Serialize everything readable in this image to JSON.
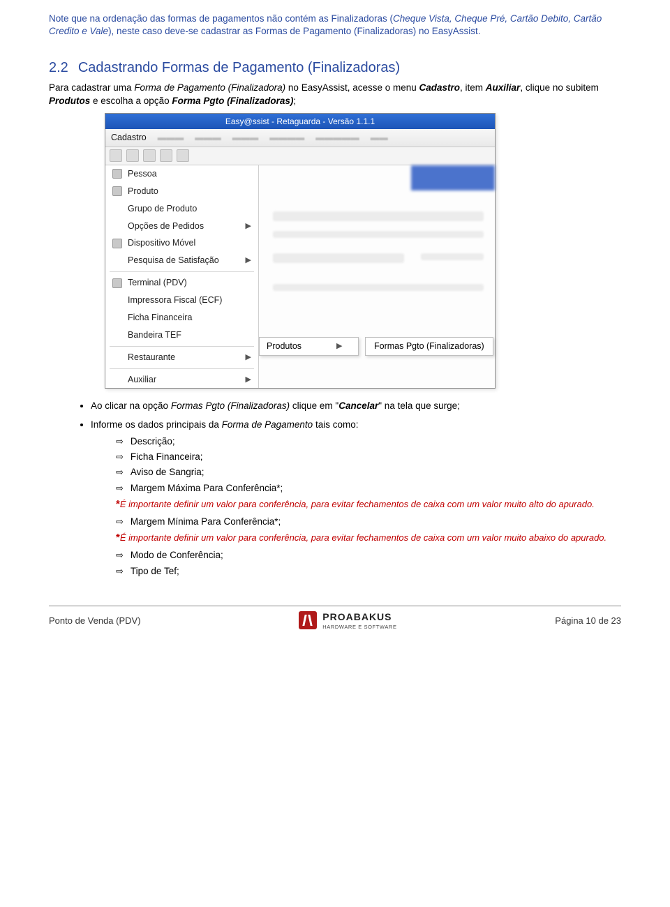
{
  "intro_note": {
    "prefix": "Note que na ordenação das formas de pagamentos não contém as Finalizadoras (",
    "examples": "Cheque Vista, Cheque Pré, Cartão Debito, Cartão Credito e Vale",
    "suffix": "), neste caso deve-se cadastrar as Formas de Pagamento (Finalizadoras) no EasyAssist."
  },
  "section": {
    "number": "2.2",
    "title": "Cadastrando Formas de Pagamento (Finalizadoras)",
    "body_parts": {
      "p1": "Para cadastrar uma ",
      "p2_it": "Forma de Pagamento (Finalizadora)",
      "p3": " no EasyAssist, acesse o menu ",
      "p4_bi": "Cadastro",
      "p5": ", item ",
      "p6_bi": "Auxiliar",
      "p7": ", clique no subitem ",
      "p8_bi": "Produtos",
      "p9": " e escolha a opção ",
      "p10_bi": "Forma Pgto (Finalizadoras)",
      "p11": ";"
    }
  },
  "screenshot": {
    "titlebar": "Easy@ssist - Retaguarda - Versão 1.1.1",
    "menubar_active": "Cadastro",
    "dropdown_items": [
      {
        "label": "Pessoa",
        "icon": true,
        "arrow": false
      },
      {
        "label": "Produto",
        "icon": true,
        "arrow": false
      },
      {
        "label": "Grupo de Produto",
        "icon": false,
        "arrow": false
      },
      {
        "label": "Opções de Pedidos",
        "icon": false,
        "arrow": true
      },
      {
        "label": "Dispositivo Móvel",
        "icon": true,
        "arrow": false
      },
      {
        "label": "Pesquisa de Satisfação",
        "icon": false,
        "arrow": true
      },
      {
        "label": "__sep__"
      },
      {
        "label": "Terminal (PDV)",
        "icon": true,
        "arrow": false
      },
      {
        "label": "Impressora Fiscal (ECF)",
        "icon": false,
        "arrow": false
      },
      {
        "label": "Ficha Financeira",
        "icon": false,
        "arrow": false
      },
      {
        "label": "Bandeira TEF",
        "icon": false,
        "arrow": false
      },
      {
        "label": "__sep__"
      },
      {
        "label": "Restaurante",
        "icon": false,
        "arrow": true
      },
      {
        "label": "__sep__"
      },
      {
        "label": "Auxiliar",
        "icon": false,
        "arrow": true
      }
    ],
    "flyout1": "Produtos",
    "flyout2": "Formas Pgto (Finalizadoras)"
  },
  "bullets": {
    "b1_parts": {
      "p1": "Ao clicar na opção ",
      "p2_it": "Formas Pgto (Finalizadoras)",
      "p3": " clique em \"",
      "p4_bi": "Cancelar",
      "p5": "\" na tela que surge;"
    },
    "b2_parts": {
      "p1": "Informe os dados principais da ",
      "p2_it": "Forma de Pagamento",
      "p3": " tais como:"
    },
    "sub": {
      "s1": "Descrição;",
      "s2": "Ficha Financeira;",
      "s3": "Aviso de Sangria;",
      "s4": "Margem Máxima Para Conferência*;",
      "note1": "É importante definir um valor para conferência, para evitar fechamentos de caixa com um valor muito alto do apurado.",
      "s5": "Margem Mínima Para Conferência*;",
      "note2": "É importante definir um valor para conferência, para evitar fechamentos de caixa com um valor muito abaixo do apurado.",
      "s6": "Modo de Conferência;",
      "s7": "Tipo de Tef;"
    }
  },
  "footer": {
    "left": "Ponto de Venda (PDV)",
    "brand_line1": "PROABAKUS",
    "brand_line2": "HARDWARE E SOFTWARE",
    "right": "Página 10 de 23"
  }
}
